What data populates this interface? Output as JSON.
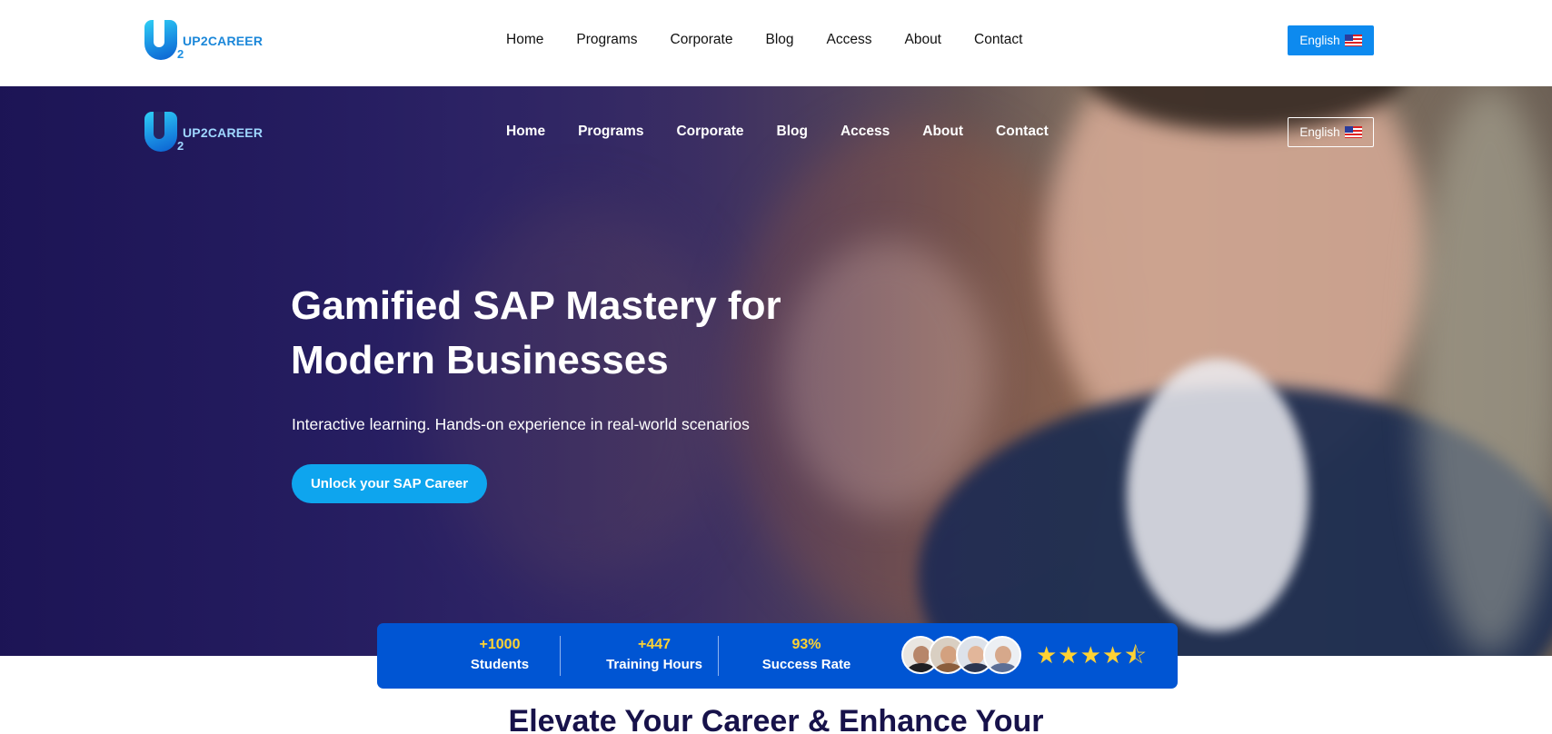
{
  "brand": {
    "name": "UP2CAREER",
    "mark_suffix": "2"
  },
  "nav": {
    "items": [
      "Home",
      "Programs",
      "Corporate",
      "Blog",
      "Access",
      "About",
      "Contact"
    ]
  },
  "language": {
    "label": "English",
    "flag_icon": "us-flag-icon"
  },
  "hero": {
    "title": "Gamified SAP Mastery for Modern Businesses",
    "subtitle": "Interactive learning. Hands-on experience in real-world scenarios",
    "cta_label": "Unlock your SAP Career"
  },
  "stats": [
    {
      "value": "+1000",
      "label": "Students"
    },
    {
      "value": "+447",
      "label": "Training Hours"
    },
    {
      "value": "93%",
      "label": "Success Rate"
    }
  ],
  "rating": {
    "stars": "★★★★⯪",
    "value": 4.5,
    "max": 5
  },
  "section": {
    "title": "Elevate Your Career & Enhance Your"
  },
  "colors": {
    "primary": "#0055d3",
    "accent": "#0ea5ee",
    "highlight": "#ffd233",
    "heading": "#17124a"
  }
}
